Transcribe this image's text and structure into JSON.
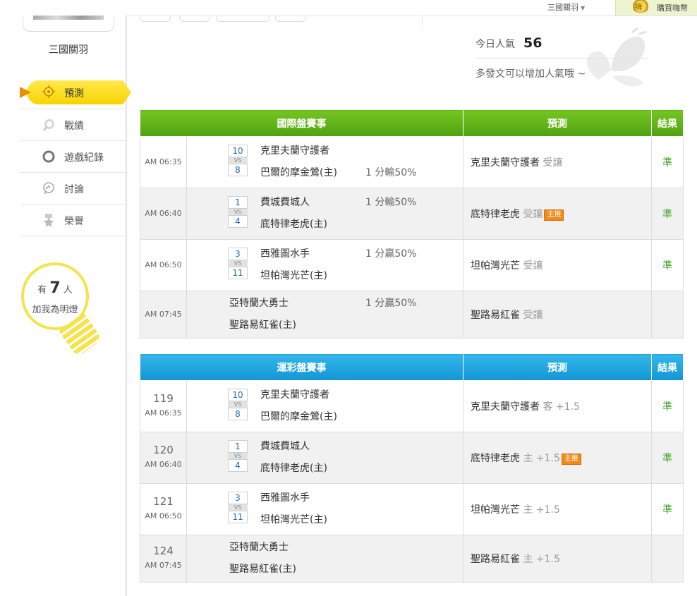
{
  "topbar": {
    "user": "三國關羽",
    "buy_label": "購買嗨幣",
    "coin_glyph": "嗨"
  },
  "sidebar": {
    "username": "三國關羽",
    "menu": [
      {
        "label": "預測",
        "icon": "crosshair-icon",
        "active": true
      },
      {
        "label": "戰績",
        "icon": "chat-bubble-icon"
      },
      {
        "label": "遊戲紀錄",
        "icon": "ring-icon"
      },
      {
        "label": "討論",
        "icon": "comment-icon"
      },
      {
        "label": "榮譽",
        "icon": "medal-icon"
      }
    ],
    "fans": {
      "prefix": "有",
      "count": "7",
      "suffix": "人",
      "caption": "加我為明燈"
    }
  },
  "popularity": {
    "label": "今日人氣",
    "value": "56",
    "hint": "多發文可以增加人氣哦 ~"
  },
  "intl_table": {
    "headers": [
      "國際盤賽事",
      "預測",
      "結果"
    ],
    "rows": [
      {
        "time": "AM 06:35",
        "score_away": "10",
        "vs": "VS",
        "score_home": "8",
        "away": "克里夫蘭守護者",
        "home": "巴爾的摩金鶯(主)",
        "handicap": "1 分輸50%",
        "handicap_row": "home",
        "pred_team": "克里夫蘭守護者",
        "pred_type": "受讓",
        "tag": "",
        "result": "準"
      },
      {
        "time": "AM 06:40",
        "score_away": "1",
        "vs": "VS",
        "score_home": "4",
        "away": "費城費城人",
        "home": "底特律老虎(主)",
        "handicap": "1 分輸50%",
        "handicap_row": "away",
        "pred_team": "底特律老虎",
        "pred_type": "受讓",
        "tag": "主推",
        "result": "準"
      },
      {
        "time": "AM 06:50",
        "score_away": "3",
        "vs": "VS",
        "score_home": "11",
        "away": "西雅圖水手",
        "home": "坦帕灣光芒(主)",
        "handicap": "1 分贏50%",
        "handicap_row": "away",
        "pred_team": "坦帕灣光芒",
        "pred_type": "受讓",
        "tag": "",
        "result": "準"
      },
      {
        "time": "AM 07:45",
        "score_away": "",
        "vs": "",
        "score_home": "",
        "away": "亞特蘭大勇士",
        "home": "聖路易紅雀(主)",
        "handicap": "1 分贏50%",
        "handicap_row": "away",
        "pred_team": "聖路易紅雀",
        "pred_type": "受讓",
        "tag": "",
        "result": ""
      }
    ]
  },
  "lottery_table": {
    "headers": [
      "運彩盤賽事",
      "預測",
      "結果"
    ],
    "rows": [
      {
        "num": "119",
        "time": "AM 06:35",
        "score_away": "10",
        "vs": "VS",
        "score_home": "8",
        "away": "克里夫蘭守護者",
        "home": "巴爾的摩金鶯(主)",
        "pred_team": "克里夫蘭守護者",
        "pred_type": "客 +1.5",
        "tag": "",
        "result": "準"
      },
      {
        "num": "120",
        "time": "AM 06:40",
        "score_away": "1",
        "vs": "VS",
        "score_home": "4",
        "away": "費城費城人",
        "home": "底特律老虎(主)",
        "pred_team": "底特律老虎",
        "pred_type": "主 +1.5",
        "tag": "主推",
        "result": "準"
      },
      {
        "num": "121",
        "time": "AM 06:50",
        "score_away": "3",
        "vs": "VS",
        "score_home": "11",
        "away": "西雅圖水手",
        "home": "坦帕灣光芒(主)",
        "pred_team": "坦帕灣光芒",
        "pred_type": "主 +1.5",
        "tag": "",
        "result": "準"
      },
      {
        "num": "124",
        "time": "AM 07:45",
        "score_away": "",
        "vs": "",
        "score_home": "",
        "away": "亞特蘭大勇士",
        "home": "聖路易紅雀(主)",
        "pred_team": "聖路易紅雀",
        "pred_type": "主 +1.5",
        "tag": "",
        "result": ""
      }
    ]
  },
  "colors": {
    "accent_yellow": "#f7d400",
    "green_header": "#5aae14",
    "blue_header": "#1a9fdc",
    "result_green": "#3ea320",
    "tag_orange": "#f08a1a"
  }
}
